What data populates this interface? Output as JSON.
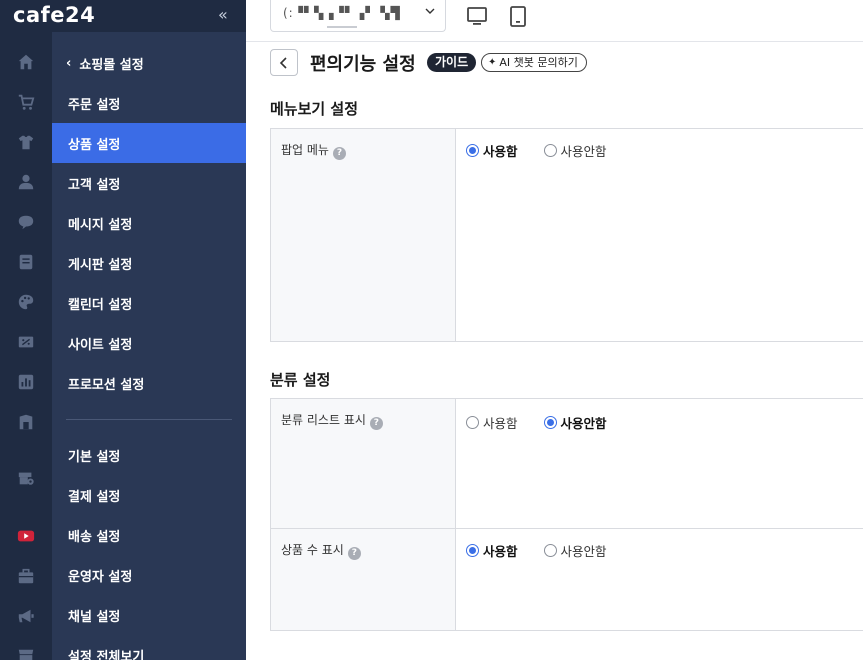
{
  "brand": {
    "logo": "cafe24",
    "collapse_icon": "double-chevron-left-icon"
  },
  "topbar": {
    "shop_selector": {
      "value": "(:▝▘▚▗▝▘▗▘ ▚▜",
      "icon": "chevron-down-icon"
    },
    "device_icons": [
      "desktop-icon",
      "mobile-icon"
    ]
  },
  "rail_icons": [
    "home-icon",
    "cart-icon",
    "shirt-icon",
    "user-icon",
    "chat-icon",
    "board-icon",
    "palette-icon",
    "promotion-icon",
    "chart-icon",
    "shop-icon",
    "store-settings-icon",
    "youtube-icon",
    "bag-icon",
    "megaphone-icon",
    "store-icon"
  ],
  "menu": {
    "back_label": "쇼핑몰 설정",
    "items": [
      {
        "label": "주문 설정"
      },
      {
        "label": "상품 설정",
        "active": true
      },
      {
        "label": "고객 설정"
      },
      {
        "label": "메시지 설정"
      },
      {
        "label": "게시판 설정"
      },
      {
        "label": "캘린더 설정"
      },
      {
        "label": "사이트 설정"
      },
      {
        "label": "프로모션 설정"
      }
    ],
    "items2": [
      {
        "label": "기본 설정"
      },
      {
        "label": "결제 설정"
      },
      {
        "label": "배송 설정"
      },
      {
        "label": "운영자 설정"
      },
      {
        "label": "채널 설정"
      },
      {
        "label": "설정 전체보기"
      }
    ]
  },
  "page": {
    "title": "편의기능 설정",
    "guide_label": "가이드",
    "ai_label": "AI 챗봇 문의하기"
  },
  "sections": [
    {
      "title": "메뉴보기 설정",
      "rows": [
        {
          "label": "팝업 메뉴",
          "options": [
            "사용함",
            "사용안함"
          ],
          "selected": 0
        }
      ]
    },
    {
      "title": "분류 설정",
      "rows": [
        {
          "label": "분류 리스트 표시",
          "options": [
            "사용함",
            "사용안함"
          ],
          "selected": 1
        },
        {
          "label": "상품 수 표시",
          "options": [
            "사용함",
            "사용안함"
          ],
          "selected": 0
        }
      ]
    }
  ],
  "colors": {
    "rail": "#1f2b42",
    "menu": "#2a3855",
    "active": "#3b6ce6",
    "radio": "#3a6fe6"
  }
}
